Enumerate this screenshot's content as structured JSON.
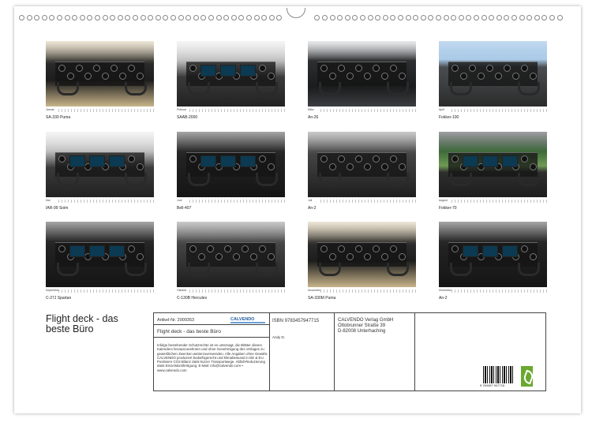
{
  "calendar": {
    "title": "Flight deck - das beste Büro",
    "months": [
      {
        "month": "Januar",
        "caption": "SA-330 Puma",
        "scene": "sand"
      },
      {
        "month": "Februar",
        "caption": "SAAB-2000",
        "scene": "white"
      },
      {
        "month": "März",
        "caption": "An-26",
        "scene": "gray"
      },
      {
        "month": "April",
        "caption": "Fokker-100",
        "scene": "sky"
      },
      {
        "month": "Mai",
        "caption": "IAR-99 Soim",
        "scene": "white"
      },
      {
        "month": "Juni",
        "caption": "Bell-407",
        "scene": "dark"
      },
      {
        "month": "Juli",
        "caption": "An-2",
        "scene": "mono"
      },
      {
        "month": "August",
        "caption": "Fokker-70",
        "scene": "land"
      },
      {
        "month": "September",
        "caption": "C-27J Spartan",
        "scene": "dark"
      },
      {
        "month": "Oktober",
        "caption": "C-130B Hercules",
        "scene": "mono"
      },
      {
        "month": "November",
        "caption": "SA-330M Puma",
        "scene": "sand"
      },
      {
        "month": "Dezember",
        "caption": "An-2",
        "scene": "dark"
      }
    ]
  },
  "info": {
    "article": "Artikel-Nr. 2009353",
    "logo_text": "CALVENDO",
    "calendar_name": "Flight deck - das beste Büro",
    "notice": "Infolge bestehender Schutzrechte ist es untersagt, die Blätter dieses Kalenders herauszunehmen und ohne Genehmigung des Verlages zu gewerblichen Zwecken weiterzuverwenden. Alle Angaben ohne Gewähr. CALVENDO produziert bedarfsgerecht und klimabewusst in DE & EU. Positivere CO2-Bilanz dank kurzer Transportwege. Abfall-Reduzierung dank Einzelstückfertigung. E-Mail: info@calvendo.com • www.calvendo.com",
    "isbn": "ISBN 9783457947715",
    "author": "Andy D.",
    "publisher_name": "CALVENDO Verlag GmbH",
    "publisher_street": "Ottobrunner Straße 39",
    "publisher_city": "D-82008 Unterhaching",
    "barcode_number": "9 783457 947715"
  }
}
